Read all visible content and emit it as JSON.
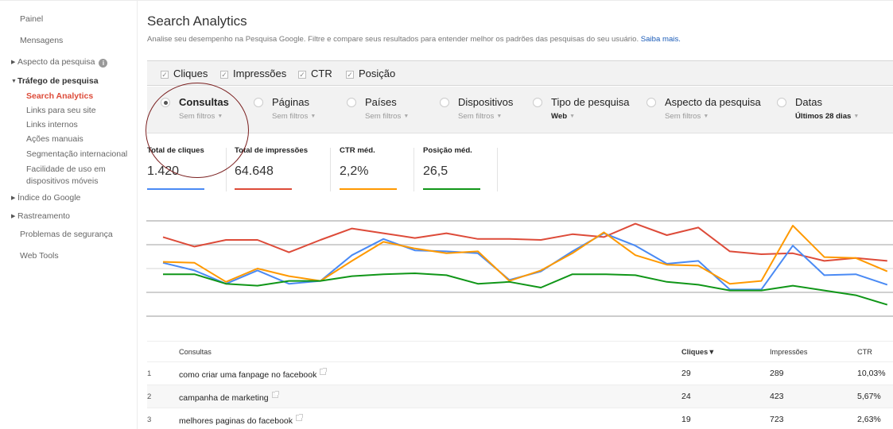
{
  "sidebar": {
    "items": [
      {
        "label": "Painel",
        "type": "item"
      },
      {
        "label": "Mensagens",
        "type": "item"
      },
      {
        "label": "Aspecto da pesquisa",
        "type": "section-collapsed",
        "info_icon": "info-icon"
      },
      {
        "label": "Tráfego de pesquisa",
        "type": "section-expanded"
      },
      {
        "label": "Search Analytics",
        "type": "sub-active"
      },
      {
        "label": "Links para seu site",
        "type": "sub"
      },
      {
        "label": "Links internos",
        "type": "sub"
      },
      {
        "label": "Ações manuais",
        "type": "sub"
      },
      {
        "label": "Segmentação internacional",
        "type": "sub"
      },
      {
        "label": "Facilidade de uso em",
        "label2": "dispositivos móveis",
        "type": "sub"
      },
      {
        "label": "Índice do Google",
        "type": "section-collapsed"
      },
      {
        "label": "Rastreamento",
        "type": "section-collapsed"
      },
      {
        "label": "Problemas de segurança",
        "type": "item"
      },
      {
        "label": "Web Tools",
        "type": "item"
      }
    ]
  },
  "header": {
    "title": "Search Analytics",
    "subtitle": "Analise seu desempenho na Pesquisa Google. Filtre e compare seus resultados para entender melhor os padrões das pesquisas do seu usuário.",
    "learn_more": "Saiba mais."
  },
  "metrics_toggles": [
    {
      "label": "Cliques",
      "checked": true
    },
    {
      "label": "Impressões",
      "checked": true
    },
    {
      "label": "CTR",
      "checked": true
    },
    {
      "label": "Posição",
      "checked": true
    }
  ],
  "groupings": [
    {
      "label": "Consultas",
      "filter": "Sem filtros",
      "selected": true
    },
    {
      "label": "Páginas",
      "filter": "Sem filtros",
      "selected": false
    },
    {
      "label": "Países",
      "filter": "Sem filtros",
      "selected": false
    },
    {
      "label": "Dispositivos",
      "filter": "Sem filtros",
      "selected": false
    },
    {
      "label": "Tipo de pesquisa",
      "filter": "Web",
      "selected": false
    },
    {
      "label": "Aspecto da pesquisa",
      "filter": "Sem filtros",
      "selected": false
    },
    {
      "label": "Datas",
      "filter": "Últimos 28 dias",
      "selected": false
    }
  ],
  "totals": [
    {
      "label": "Total de cliques",
      "value": "1.420",
      "color": "#4a8af4"
    },
    {
      "label": "Total de impressões",
      "value": "64.648",
      "color": "#dd4b39"
    },
    {
      "label": "CTR méd.",
      "value": "2,2%",
      "color": "#ff9900"
    },
    {
      "label": "Posição méd.",
      "value": "26,5",
      "color": "#109618"
    }
  ],
  "chart_data": {
    "type": "line",
    "title": "",
    "xlabel": "",
    "ylabel": "",
    "note": "Normalized relative scale (no axis ticks shown); values 0-100 relative to plot height, 24 daily points",
    "ylim": [
      0,
      100
    ],
    "x": [
      1,
      2,
      3,
      4,
      5,
      6,
      7,
      8,
      9,
      10,
      11,
      12,
      13,
      14,
      15,
      16,
      17,
      18,
      19,
      20,
      21,
      22,
      23,
      24
    ],
    "grid": true,
    "series": [
      {
        "name": "Impressões",
        "color": "#dd4b39",
        "values": [
          83,
          73,
          80,
          80,
          67,
          80,
          92,
          87,
          82,
          87,
          81,
          81,
          80,
          86,
          83,
          97,
          85,
          93,
          68,
          65,
          66,
          58,
          61,
          58
        ]
      },
      {
        "name": "Cliques",
        "color": "#4a8af4",
        "values": [
          56,
          48,
          34,
          48,
          34,
          37,
          64,
          81,
          69,
          68,
          66,
          38,
          47,
          68,
          87,
          74,
          55,
          58,
          28,
          28,
          74,
          43,
          44,
          33
        ]
      },
      {
        "name": "CTR",
        "color": "#ff9900",
        "values": [
          57,
          56,
          36,
          50,
          42,
          37,
          58,
          78,
          71,
          66,
          68,
          37,
          48,
          66,
          88,
          64,
          54,
          53,
          34,
          37,
          95,
          62,
          61,
          47
        ]
      },
      {
        "name": "Posição",
        "color": "#109618",
        "values": [
          44,
          44,
          34,
          32,
          37,
          37,
          42,
          44,
          45,
          43,
          34,
          36,
          30,
          44,
          44,
          43,
          36,
          33,
          27,
          27,
          32,
          27,
          22,
          12
        ]
      }
    ]
  },
  "table": {
    "headers": {
      "index": "",
      "query": "Consultas",
      "clicks": "Cliques",
      "clicks_sort": "▼",
      "impressions": "Impressões",
      "ctr": "CTR"
    },
    "rows": [
      {
        "index": "1",
        "query": "como criar uma fanpage no facebook",
        "clicks": "29",
        "impressions": "289",
        "ctr": "10,03%"
      },
      {
        "index": "2",
        "query": "campanha de marketing",
        "clicks": "24",
        "impressions": "423",
        "ctr": "5,67%"
      },
      {
        "index": "3",
        "query": "melhores paginas do facebook",
        "clicks": "19",
        "impressions": "723",
        "ctr": "2,63%"
      }
    ]
  }
}
